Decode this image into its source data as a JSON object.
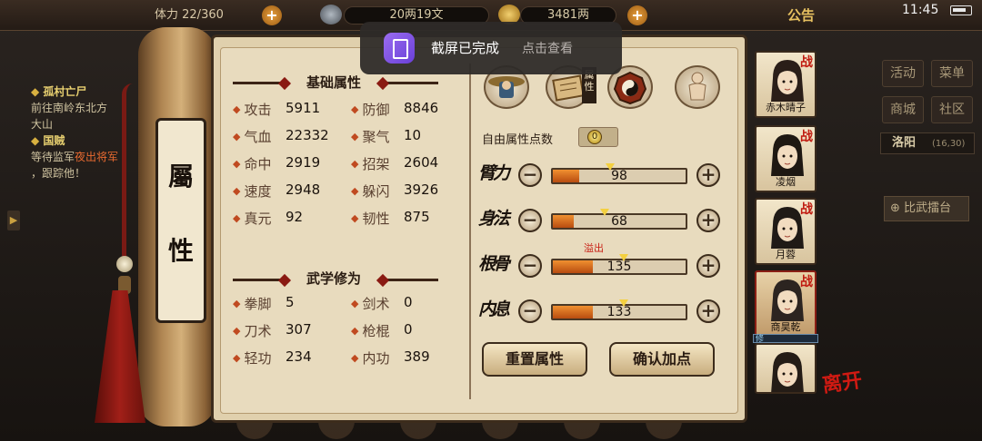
{
  "topbar": {
    "stamina": "22/360",
    "money": "20两19文",
    "gold": "3481两",
    "notice": "公告",
    "time": "11:45"
  },
  "quest": {
    "title1": "孤村亡尸",
    "text1": "前往南岭东北方",
    "text1b": "大山",
    "title2": "国贼",
    "text2a": "等待监军",
    "text2_highlight": "夜出将军",
    "text2b": "，跟踪他！"
  },
  "right_menu": {
    "b1": "活动",
    "b2": "菜单",
    "b3": "商城",
    "b4": "社区",
    "city": "洛阳",
    "city_coord": "(16,30)",
    "challenge": "比武擂台"
  },
  "scroll": {
    "label_top": "屬",
    "label_bottom": "性"
  },
  "base_attrs": {
    "title": "基础属性",
    "items": [
      {
        "label": "攻击",
        "value": "5911"
      },
      {
        "label": "防御",
        "value": "8846"
      },
      {
        "label": "气血",
        "value": "22332"
      },
      {
        "label": "聚气",
        "value": "10"
      },
      {
        "label": "命中",
        "value": "2919"
      },
      {
        "label": "招架",
        "value": "2604"
      },
      {
        "label": "速度",
        "value": "2948"
      },
      {
        "label": "躲闪",
        "value": "3926"
      },
      {
        "label": "真元",
        "value": "92"
      },
      {
        "label": "韧性",
        "value": "875"
      }
    ]
  },
  "martial": {
    "title": "武学修为",
    "items": [
      {
        "label": "拳脚",
        "value": "5"
      },
      {
        "label": "剑术",
        "value": "0"
      },
      {
        "label": "刀术",
        "value": "307"
      },
      {
        "label": "枪棍",
        "value": "0"
      },
      {
        "label": "轻功",
        "value": "234"
      },
      {
        "label": "内功",
        "value": "389"
      }
    ]
  },
  "tabs": {
    "active_label": "属性",
    "icons": [
      "character-hat-icon",
      "scroll-map-icon",
      "bagua-icon",
      "meridian-body-icon"
    ]
  },
  "free_points": {
    "label": "自由属性点数",
    "value": "0"
  },
  "attributes": [
    {
      "name": "臂力",
      "value": "98",
      "fill": 0.2
    },
    {
      "name": "身法",
      "value": "68",
      "fill": 0.16
    },
    {
      "name": "根骨",
      "value": "135",
      "fill": 0.3,
      "overflow": "溢出"
    },
    {
      "name": "内息",
      "value": "133",
      "fill": 0.3
    }
  ],
  "buttons": {
    "reset": "重置属性",
    "confirm": "确认加点"
  },
  "characters": [
    {
      "name": "赤木晴子",
      "tag": "战"
    },
    {
      "name": "凌烟",
      "tag": "战"
    },
    {
      "name": "月蓉",
      "tag": "战"
    },
    {
      "name": "商昊乾",
      "tag": "战"
    },
    {
      "name": "",
      "tag": ""
    }
  ],
  "cultivation_tag": "修",
  "leave": "离开",
  "toast": {
    "title": "截屏已完成",
    "action": "点击查看"
  },
  "colors": {
    "accent": "#c04a20",
    "bar_fill": "#e07a20",
    "paper": "#e8dbbe",
    "tag_red": "#c01a10"
  }
}
